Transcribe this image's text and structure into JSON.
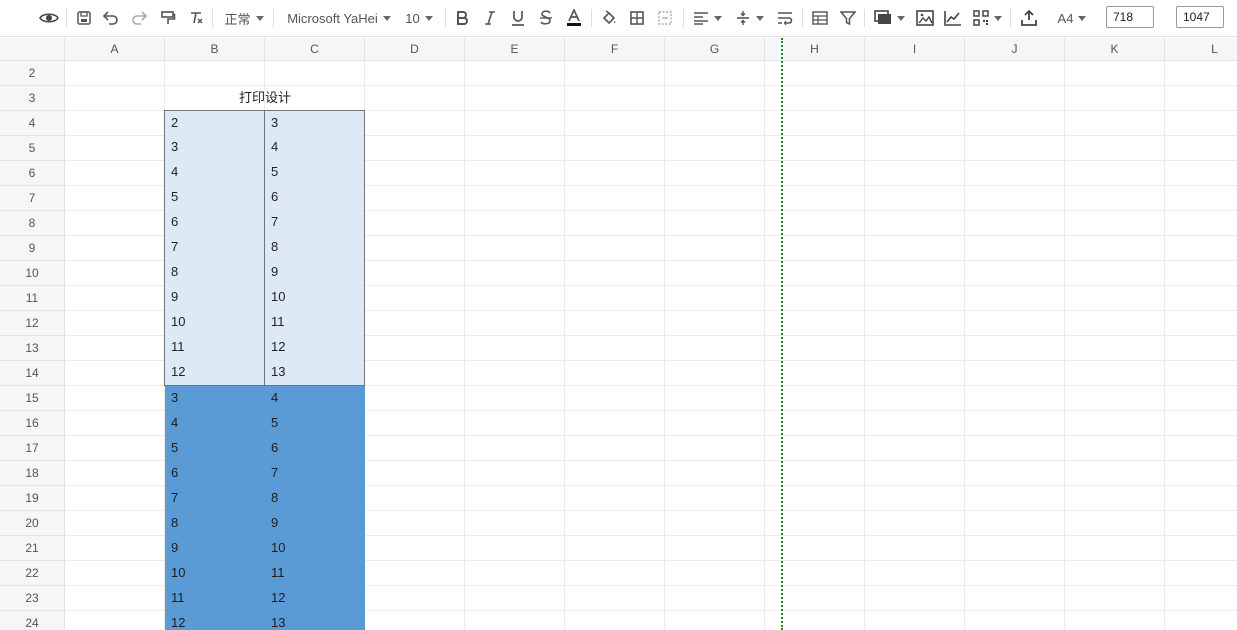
{
  "toolbar": {
    "style_label": "正常",
    "font_name": "Microsoft YaHei",
    "font_size": "10",
    "page_size": "A4",
    "width_value": "718",
    "height_value": "1047"
  },
  "columns": [
    "A",
    "B",
    "C",
    "D",
    "E",
    "F",
    "G",
    "H",
    "I",
    "J",
    "K",
    "L"
  ],
  "rows": [
    "2",
    "3",
    "4",
    "5",
    "6",
    "7",
    "8",
    "9",
    "10",
    "11",
    "12",
    "13",
    "14",
    "15",
    "16",
    "17",
    "18",
    "19",
    "20",
    "21",
    "22",
    "23",
    "24"
  ],
  "sheet": {
    "title": "打印设计",
    "light_rows": [
      [
        "2",
        "3"
      ],
      [
        "3",
        "4"
      ],
      [
        "4",
        "5"
      ],
      [
        "5",
        "6"
      ],
      [
        "6",
        "7"
      ],
      [
        "7",
        "8"
      ],
      [
        "8",
        "9"
      ],
      [
        "9",
        "10"
      ],
      [
        "10",
        "11"
      ],
      [
        "11",
        "12"
      ],
      [
        "12",
        "13"
      ]
    ],
    "dark_rows": [
      [
        "3",
        "4"
      ],
      [
        "4",
        "5"
      ],
      [
        "5",
        "6"
      ],
      [
        "6",
        "7"
      ],
      [
        "7",
        "8"
      ],
      [
        "8",
        "9"
      ],
      [
        "9",
        "10"
      ],
      [
        "10",
        "11"
      ],
      [
        "11",
        "12"
      ],
      [
        "12",
        "13"
      ]
    ]
  },
  "colors": {
    "light_fill": "#dde9f5",
    "dark_fill": "#5b9bd5",
    "page_break": "#1d8a2a"
  }
}
